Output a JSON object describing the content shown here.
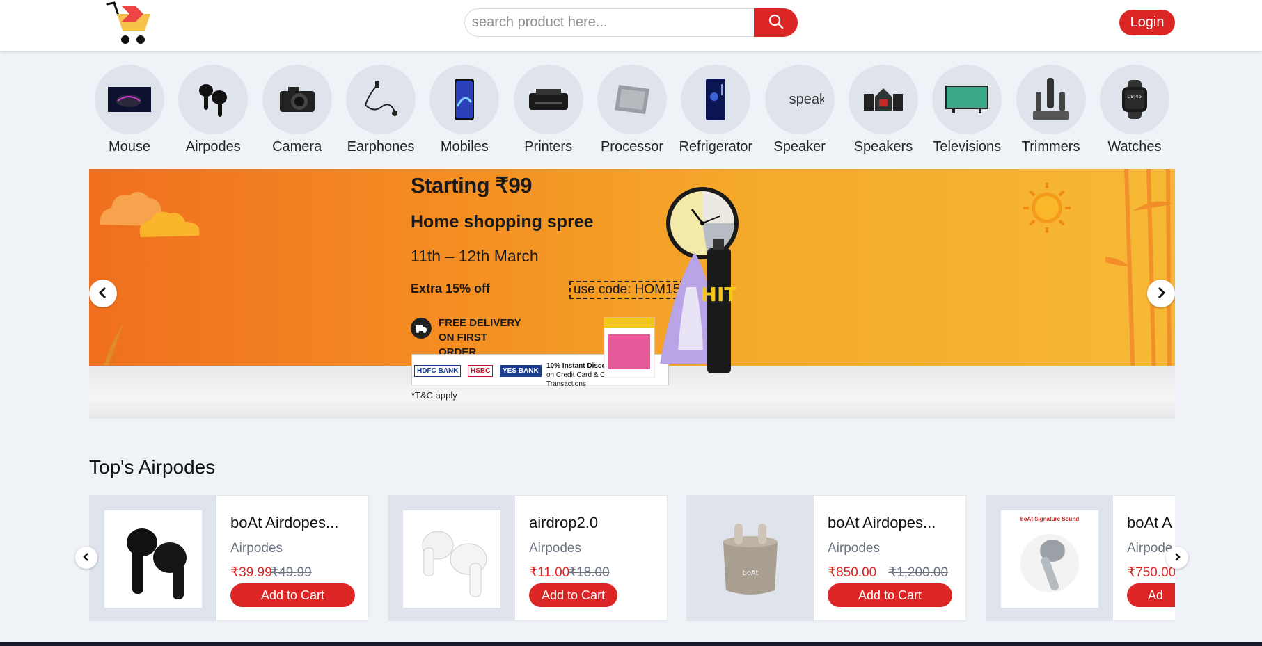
{
  "header": {
    "search_placeholder": "search product here...",
    "login_label": "Login",
    "accent_color": "#dc2626"
  },
  "categories": [
    {
      "label": "Mouse",
      "icon": "mouse-image"
    },
    {
      "label": "Airpodes",
      "icon": "airpodes-image"
    },
    {
      "label": "Camera",
      "icon": "camera-image"
    },
    {
      "label": "Earphones",
      "icon": "earphones-image"
    },
    {
      "label": "Mobiles",
      "icon": "mobile-image"
    },
    {
      "label": "Printers",
      "icon": "printer-image"
    },
    {
      "label": "Processor",
      "icon": "processor-image"
    },
    {
      "label": "Refrigerator",
      "icon": "refrigerator-image"
    },
    {
      "label": "Speaker",
      "icon": "broken-image",
      "alt_text": "speake"
    },
    {
      "label": "Speakers",
      "icon": "speakers-image"
    },
    {
      "label": "Televisions",
      "icon": "television-image"
    },
    {
      "label": "Trimmers",
      "icon": "trimmer-image"
    },
    {
      "label": "Watches",
      "icon": "watch-image"
    }
  ],
  "banner": {
    "starting": "Starting ₹99",
    "headline": "Home shopping spree",
    "dates": "11th – 12th March",
    "extra_offer": "Extra 15% off",
    "coupon": "use code: HOM15",
    "delivery_line1": "FREE DELIVERY",
    "delivery_line2": "ON FIRST ORDER",
    "banks": [
      "HDFC BANK",
      "HSBC",
      "YES BANK"
    ],
    "instant_discount": "10% Instant Discount*",
    "instant_discount_note": "on Credit Card & Credit Card EMI Transactions",
    "tc": "*T&C apply"
  },
  "section": {
    "title": "Top's Airpodes"
  },
  "products": [
    {
      "name": "boAt Airdopes...",
      "category": "Airpodes",
      "price": "₹39.99",
      "old_price": "₹49.99",
      "cart_label": "Add to Cart"
    },
    {
      "name": "airdrop2.0",
      "category": "Airpodes",
      "price": "₹11.00",
      "old_price": "₹18.00",
      "cart_label": "Add to Cart"
    },
    {
      "name": "boAt Airdopes...",
      "category": "Airpodes",
      "price": "₹850.00",
      "old_price": "₹1,200.00",
      "cart_label": "Add to Cart"
    },
    {
      "name": "boAt A",
      "category": "Airpode",
      "price": "₹750.00",
      "old_price": "",
      "cart_label": "Ad"
    }
  ],
  "product4_brand": "boAt Signature Sound"
}
